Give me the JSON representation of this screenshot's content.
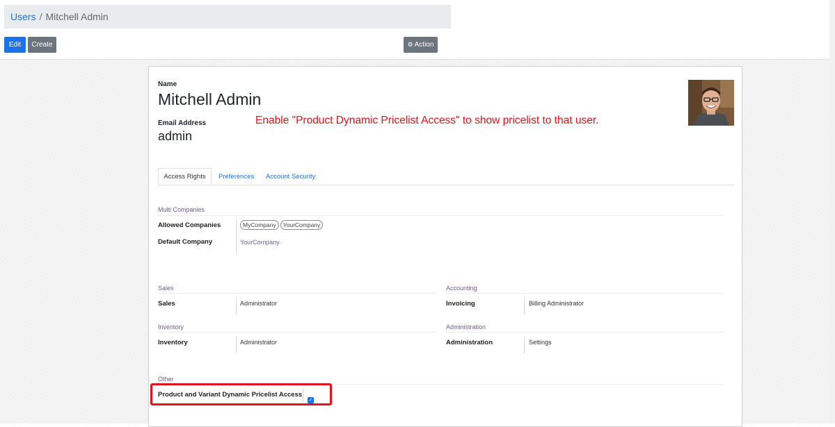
{
  "breadcrumb": {
    "parent": "Users",
    "separator": "/",
    "current": "Mitchell Admin"
  },
  "toolbar": {
    "edit_label": "Edit",
    "create_label": "Create",
    "action_label": "Action"
  },
  "form": {
    "name_label": "Name",
    "name_value": "Mitchell Admin",
    "email_label": "Email Address",
    "email_value": "admin",
    "note": "Enable \"Product Dynamic Pricelist Access\" to show pricelist to that user."
  },
  "tabs": [
    {
      "label": "Access Rights",
      "active": true
    },
    {
      "label": "Preferences",
      "active": false
    },
    {
      "label": "Account Security",
      "active": false
    }
  ],
  "multi_companies": {
    "title": "Multi Companies",
    "allowed_label": "Allowed Companies",
    "allowed_tags": [
      "MyCompany",
      "YourCompany"
    ],
    "default_label": "Default Company",
    "default_value": "YourCompany"
  },
  "sales": {
    "title": "Sales",
    "label": "Sales",
    "value": "Administrator"
  },
  "accounting": {
    "title": "Accounting",
    "label": "Invoicing",
    "value": "Billing Administrator"
  },
  "inventory": {
    "title": "Inventory",
    "label": "Inventory",
    "value": "Administrator"
  },
  "administration": {
    "title": "Administration",
    "label": "Administration",
    "value": "Settings"
  },
  "other": {
    "title": "Other",
    "label": "Product and Variant Dynamic Pricelist Access",
    "checked": true
  },
  "colors": {
    "primary": "#1a73e8",
    "secondary": "#6c757d",
    "annotation": "#e0141c",
    "section": "#6f5d97"
  }
}
